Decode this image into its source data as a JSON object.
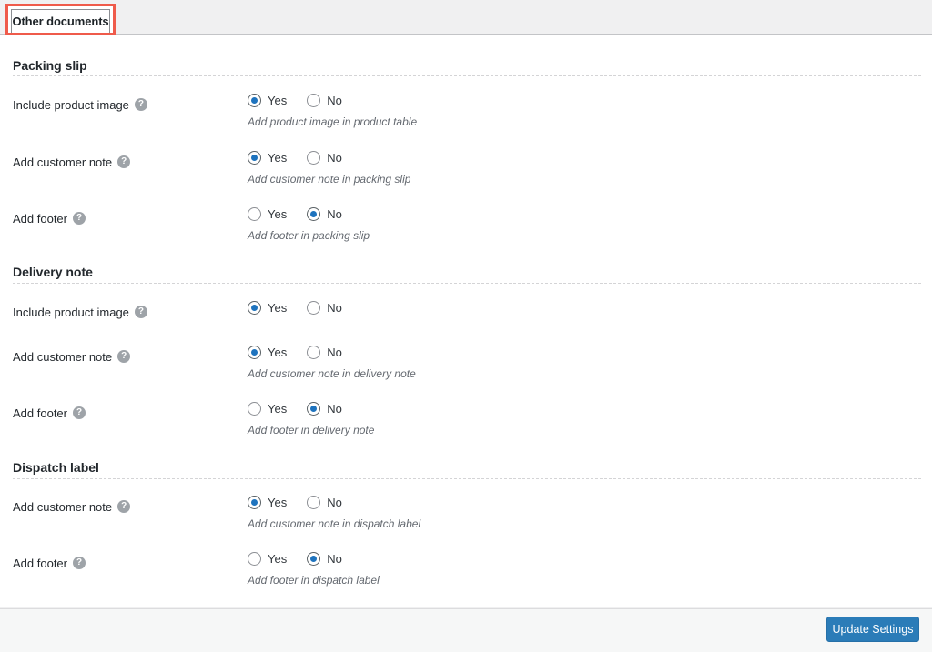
{
  "tab": {
    "label": "Other documents",
    "highlight_color": "#ef5b4b"
  },
  "help_icon_glyph": "?",
  "radio_labels": {
    "yes": "Yes",
    "no": "No"
  },
  "sections": [
    {
      "title": "Packing slip",
      "rows": [
        {
          "label": "Include product image",
          "help": "help-icon",
          "value": "yes",
          "description": "Add product image in product table"
        },
        {
          "label": "Add customer note",
          "help": "help-icon",
          "value": "yes",
          "description": "Add customer note in packing slip"
        },
        {
          "label": "Add footer",
          "help": "help-icon",
          "value": "no",
          "description": "Add footer in packing slip"
        }
      ]
    },
    {
      "title": "Delivery note",
      "rows": [
        {
          "label": "Include product image",
          "help": "help-icon",
          "value": "yes",
          "description": ""
        },
        {
          "label": "Add customer note",
          "help": "help-icon",
          "value": "yes",
          "description": "Add customer note in delivery note"
        },
        {
          "label": "Add footer",
          "help": "help-icon",
          "value": "no",
          "description": "Add footer in delivery note"
        }
      ]
    },
    {
      "title": "Dispatch label",
      "rows": [
        {
          "label": "Add customer note",
          "help": "help-icon",
          "value": "yes",
          "description": "Add customer note in dispatch label"
        },
        {
          "label": "Add footer",
          "help": "help-icon",
          "value": "no",
          "description": "Add footer in dispatch label"
        }
      ]
    }
  ],
  "footer": {
    "update_label": "Update Settings",
    "button_color": "#2b7cb8"
  }
}
